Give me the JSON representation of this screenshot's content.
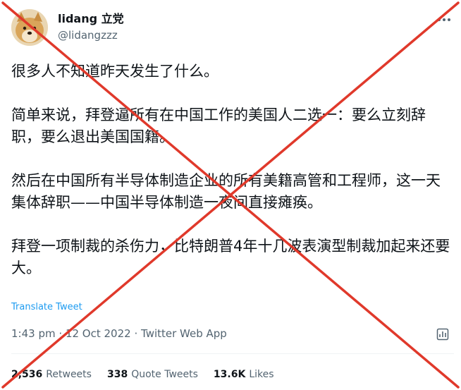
{
  "author": {
    "display_name": "lidang 立党",
    "handle": "@lidangzzz",
    "avatar_icon": "doge-dog-avatar"
  },
  "tweet": {
    "paragraphs": [
      "很多人不知道昨天发生了什么。",
      "简单来说，拜登逼所有在中国工作的美国人二选一：要么立刻辞职，要么退出美国国籍。",
      "然后在中国所有半导体制造企业的所有美籍高管和工程师，这一天集体辞职——中国半导体制造一夜间直接瘫痪。",
      "拜登一项制裁的杀伤力，比特朗普4年十几波表演型制裁加起来还要大。"
    ],
    "translate_label": "Translate Tweet"
  },
  "meta": {
    "time": "1:43 pm",
    "separator": "·",
    "date": "12 Oct 2022",
    "source": "Twitter Web App"
  },
  "stats": {
    "retweets_count": "2,536",
    "retweets_label": "Retweets",
    "quotes_count": "338",
    "quotes_label": "Quote Tweets",
    "likes_count": "13.6K",
    "likes_label": "Likes"
  },
  "icons": {
    "more": "more-horizontal-icon",
    "analytics": "analytics-icon"
  },
  "colors": {
    "text_primary": "#0f1419",
    "text_secondary": "#536471",
    "link": "#1d9bf0",
    "cross": "#e0392b",
    "divider": "#eff3f4"
  }
}
